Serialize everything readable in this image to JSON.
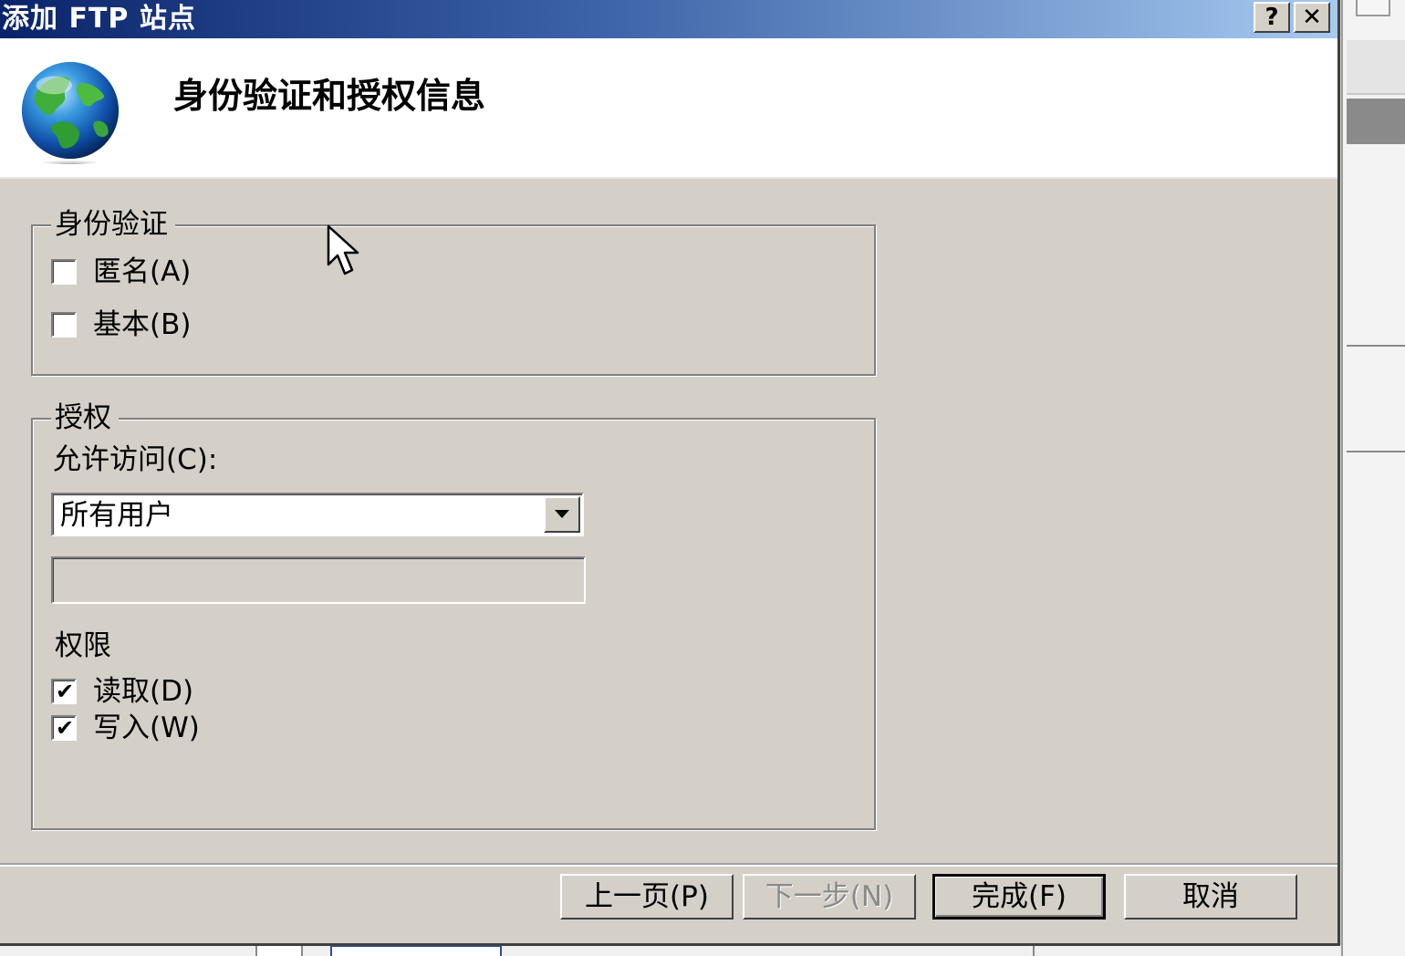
{
  "dialog": {
    "title": "添加 FTP 站点",
    "help_label": "?",
    "close_label": "✕",
    "header_title": "身份验证和授权信息"
  },
  "authentication": {
    "legend": "身份验证",
    "anonymous": {
      "label": "匿名(A)",
      "checked": false
    },
    "basic": {
      "label": "基本(B)",
      "checked": false
    }
  },
  "authorization": {
    "legend": "授权",
    "allow_access_label": "允许访问(C):",
    "allow_access_value": "所有用户",
    "allow_access_extra_value": "",
    "permissions_label": "权限",
    "read": {
      "label": "读取(D)",
      "checked": true
    },
    "write": {
      "label": "写入(W)",
      "checked": true
    }
  },
  "buttons": {
    "previous": "上一页(P)",
    "next": "下一步(N)",
    "finish": "完成(F)",
    "cancel": "取消"
  },
  "icons": {
    "globe": "globe-icon",
    "cursor": "mouse-pointer-icon",
    "dropdown": "chevron-down-icon",
    "check": "checkmark-icon"
  },
  "colors": {
    "titlebar_start": "#0a246a",
    "titlebar_end": "#a6caf0",
    "dialog_face": "#d4d0c8"
  }
}
